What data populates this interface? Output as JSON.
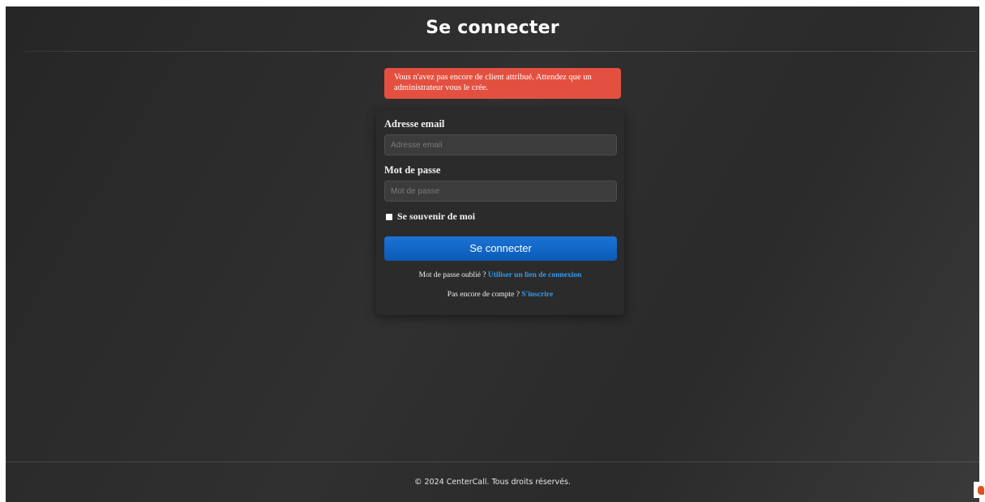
{
  "header": {
    "title": "Se connecter"
  },
  "alert": {
    "message": "Vous n'avez pas encore de client attribué. Attendez que un administrateur vous le crée.",
    "color": "#e45040"
  },
  "login_form": {
    "email_label": "Adresse email",
    "email_placeholder": "Adresse email",
    "email_value": "",
    "password_label": "Mot de passe",
    "password_placeholder": "Mot de passe",
    "password_value": "",
    "remember_label": "Se souvenir de moi",
    "remember_checked": false,
    "submit_label": "Se connecter",
    "forgot_text": "Mot de passe oublié ?",
    "magic_link_label": "Utiliser un lien de connexion",
    "no_account_text": "Pas encore de compte ?",
    "signup_label": "S'inscrire"
  },
  "footer": {
    "copyright": "© 2024 CenterCall. Tous droits réservés."
  },
  "colors": {
    "background": "#2c2c2c",
    "card": "#2b2b2b",
    "primary_button": "#1b73d4",
    "link": "#3399ee"
  },
  "icons": {
    "corner_widget": "chat-widget-icon"
  }
}
